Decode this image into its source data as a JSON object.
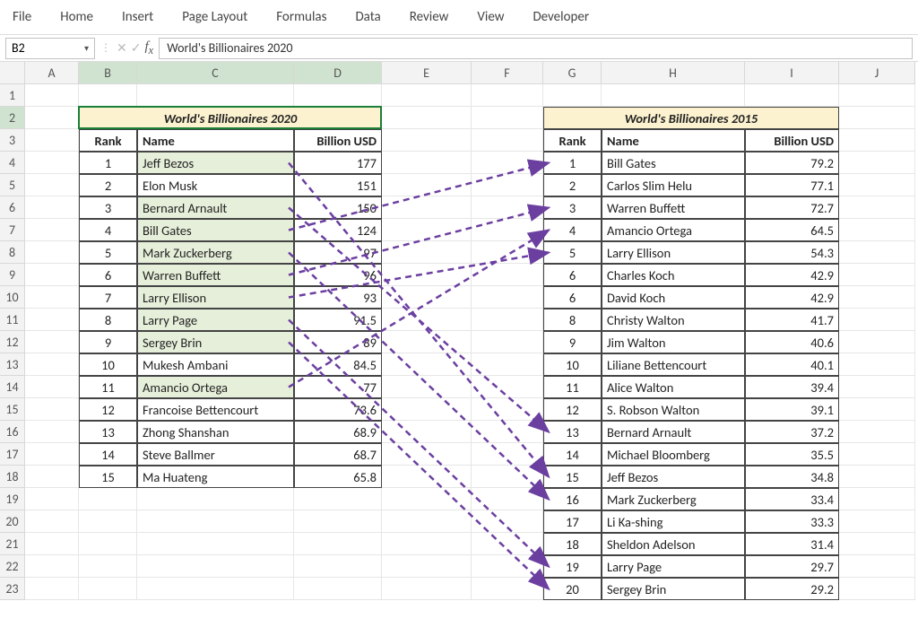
{
  "ribbon": [
    "File",
    "Home",
    "Insert",
    "Page Layout",
    "Formulas",
    "Data",
    "Review",
    "View",
    "Developer"
  ],
  "namebox": "B2",
  "formula": "World's Billionaires 2020",
  "cols": [
    "A",
    "B",
    "C",
    "D",
    "E",
    "F",
    "G",
    "H",
    "I",
    "J"
  ],
  "table2020": {
    "title": "World's Billionaires 2020",
    "headers": {
      "rank": "Rank",
      "name": "Name",
      "usd": "Billion USD"
    },
    "rows": [
      {
        "rank": 1,
        "name": "Jeff Bezos",
        "usd": "177",
        "hl": true
      },
      {
        "rank": 2,
        "name": "Elon Musk",
        "usd": "151",
        "hl": false
      },
      {
        "rank": 3,
        "name": "Bernard Arnault",
        "usd": "150",
        "hl": true
      },
      {
        "rank": 4,
        "name": "Bill Gates",
        "usd": "124",
        "hl": true
      },
      {
        "rank": 5,
        "name": "Mark Zuckerberg",
        "usd": "97",
        "hl": true
      },
      {
        "rank": 6,
        "name": "Warren Buffett",
        "usd": "96",
        "hl": true
      },
      {
        "rank": 7,
        "name": "Larry Ellison",
        "usd": "93",
        "hl": true
      },
      {
        "rank": 8,
        "name": "Larry Page",
        "usd": "91.5",
        "hl": true
      },
      {
        "rank": 9,
        "name": "Sergey Brin",
        "usd": "89",
        "hl": true
      },
      {
        "rank": 10,
        "name": "Mukesh Ambani",
        "usd": "84.5",
        "hl": false
      },
      {
        "rank": 11,
        "name": "Amancio Ortega",
        "usd": "77",
        "hl": true
      },
      {
        "rank": 12,
        "name": "Francoise Bettencourt",
        "usd": "73.6",
        "hl": false
      },
      {
        "rank": 13,
        "name": "Zhong Shanshan",
        "usd": "68.9",
        "hl": false
      },
      {
        "rank": 14,
        "name": "Steve Ballmer",
        "usd": "68.7",
        "hl": false
      },
      {
        "rank": 15,
        "name": "Ma Huateng",
        "usd": "65.8",
        "hl": false
      }
    ]
  },
  "table2015": {
    "title": "World's Billionaires 2015",
    "headers": {
      "rank": "Rank",
      "name": "Name",
      "usd": "Billion USD"
    },
    "rows": [
      {
        "rank": 1,
        "name": "Bill Gates",
        "usd": "79.2"
      },
      {
        "rank": 2,
        "name": "Carlos Slim Helu",
        "usd": "77.1"
      },
      {
        "rank": 3,
        "name": "Warren Buffett",
        "usd": "72.7"
      },
      {
        "rank": 4,
        "name": "Amancio Ortega",
        "usd": "64.5"
      },
      {
        "rank": 5,
        "name": "Larry Ellison",
        "usd": "54.3"
      },
      {
        "rank": 6,
        "name": "Charles Koch",
        "usd": "42.9"
      },
      {
        "rank": 6,
        "name": "David Koch",
        "usd": "42.9"
      },
      {
        "rank": 8,
        "name": "Christy Walton",
        "usd": "41.7"
      },
      {
        "rank": 9,
        "name": "Jim Walton",
        "usd": "40.6"
      },
      {
        "rank": 10,
        "name": "Liliane Bettencourt",
        "usd": "40.1"
      },
      {
        "rank": 11,
        "name": "Alice Walton",
        "usd": "39.4"
      },
      {
        "rank": 12,
        "name": "S. Robson Walton",
        "usd": "39.1"
      },
      {
        "rank": 13,
        "name": "Bernard Arnault",
        "usd": "37.2"
      },
      {
        "rank": 14,
        "name": "Michael Bloomberg",
        "usd": "35.5"
      },
      {
        "rank": 15,
        "name": "Jeff Bezos",
        "usd": "34.8"
      },
      {
        "rank": 16,
        "name": "Mark Zuckerberg",
        "usd": "33.4"
      },
      {
        "rank": 17,
        "name": "Li Ka-shing",
        "usd": "33.3"
      },
      {
        "rank": 18,
        "name": "Sheldon Adelson",
        "usd": "31.4"
      },
      {
        "rank": 19,
        "name": "Larry Page",
        "usd": "29.7"
      },
      {
        "rank": 20,
        "name": "Sergey Brin",
        "usd": "29.2"
      }
    ]
  },
  "arrows": [
    {
      "from2020Row": 0,
      "to2015Row": 14
    },
    {
      "from2020Row": 2,
      "to2015Row": 12
    },
    {
      "from2020Row": 3,
      "to2015Row": 0
    },
    {
      "from2020Row": 4,
      "to2015Row": 15
    },
    {
      "from2020Row": 5,
      "to2015Row": 2
    },
    {
      "from2020Row": 6,
      "to2015Row": 4
    },
    {
      "from2020Row": 7,
      "to2015Row": 18
    },
    {
      "from2020Row": 8,
      "to2015Row": 19
    },
    {
      "from2020Row": 10,
      "to2015Row": 3
    }
  ]
}
